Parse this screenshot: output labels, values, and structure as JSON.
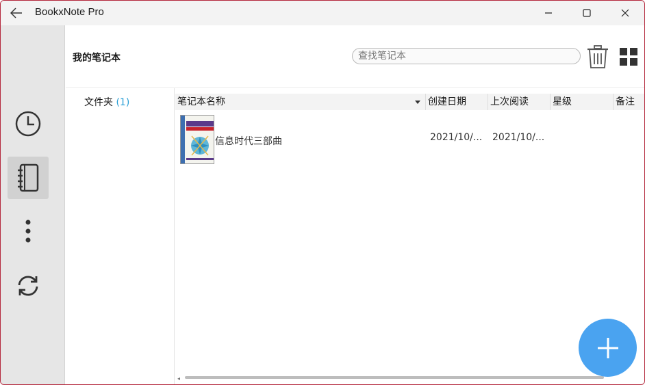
{
  "window": {
    "title": "BookxNote Pro"
  },
  "header": {
    "title": "我的笔记本",
    "search_placeholder": "查找笔记本"
  },
  "folders": {
    "label": "文件夹",
    "count": "(1)"
  },
  "table": {
    "columns": [
      "笔记本名称",
      "创建日期",
      "上次阅读",
      "星级",
      "备注"
    ],
    "rows": [
      {
        "name": "信息时代三部曲",
        "created": "2021/10/...",
        "last_read": "2021/10/...",
        "rating": "",
        "note": ""
      }
    ]
  },
  "cover": {
    "title_line": "网络社会的崛起",
    "badge": "NETWO"
  },
  "icons": {
    "back": "back-arrow-icon",
    "minimize": "minimize-icon",
    "maximize": "maximize-icon",
    "close": "close-icon",
    "recent": "clock-icon",
    "notebook": "notebook-icon",
    "more": "more-vertical-icon",
    "sync": "sync-icon",
    "trash": "trash-icon",
    "grid": "grid-view-icon",
    "add": "plus-icon"
  },
  "colors": {
    "accent": "#4aa3f0",
    "count": "#2a9fd6",
    "window_border": "#b3263a"
  }
}
